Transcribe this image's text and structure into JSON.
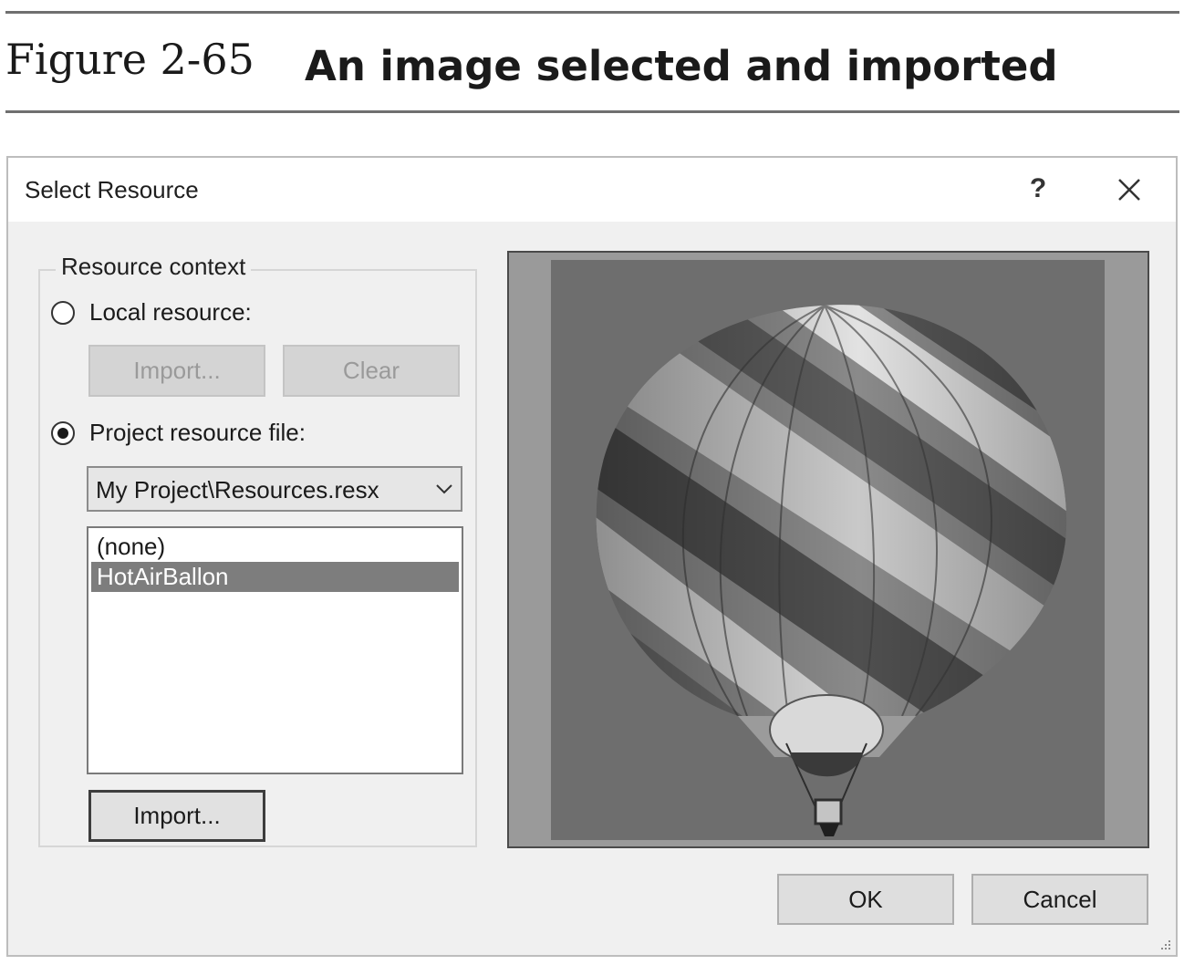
{
  "figure": {
    "label": "Figure 2-65",
    "caption": "An image selected and imported"
  },
  "dialog": {
    "title": "Select Resource",
    "help_label": "?",
    "close_icon": "close-icon",
    "resource_context": {
      "group_label": "Resource context",
      "local_resource_label": "Local resource:",
      "local_import_label": "Import...",
      "clear_label": "Clear",
      "project_resource_label": "Project resource file:",
      "selected_option": "Project resource file:",
      "resource_file_value": "My Project\\Resources.resx",
      "resource_list": [
        {
          "label": "(none)",
          "selected": false
        },
        {
          "label": "HotAirBallon",
          "selected": true
        }
      ],
      "project_import_label": "Import..."
    },
    "preview_image": "hot-air-balloon",
    "ok_label": "OK",
    "cancel_label": "Cancel"
  },
  "colors": {
    "selection": "#7d7d7d",
    "dialog_bg": "#f0f0f0",
    "preview_bg": "#9a9a9a"
  }
}
